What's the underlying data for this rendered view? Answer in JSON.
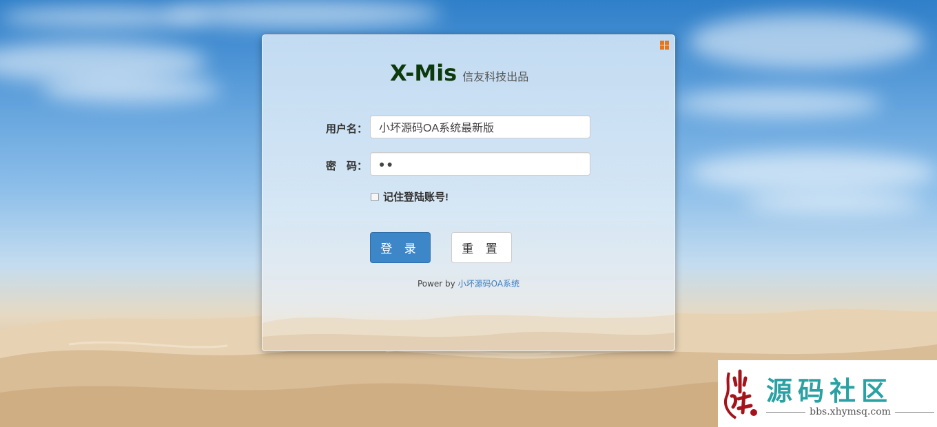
{
  "app": {
    "brand_name": "X-Mis",
    "brand_sub": "信友科技出品"
  },
  "form": {
    "username_label": "用户名：",
    "username_value": "小坏源码OA系统最新版",
    "password_label": "密　码：",
    "password_value": "●●",
    "remember_label": "记住登陆账号!",
    "remember_checked": false
  },
  "buttons": {
    "login_label": "登 录",
    "reset_label": "重 置"
  },
  "footer": {
    "power_prefix": "Power by ",
    "power_link": "小坏源码OA系统"
  },
  "watermark": {
    "title": "源码社区",
    "url": "bbs.xhymsq.com"
  },
  "colors": {
    "login_button": "#3d87c8",
    "brand_text": "#0d3a0d",
    "corner_icon": "#e8751a",
    "watermark_title": "#2aa2a4"
  },
  "icons": {
    "corner": "windows-grid-icon"
  }
}
